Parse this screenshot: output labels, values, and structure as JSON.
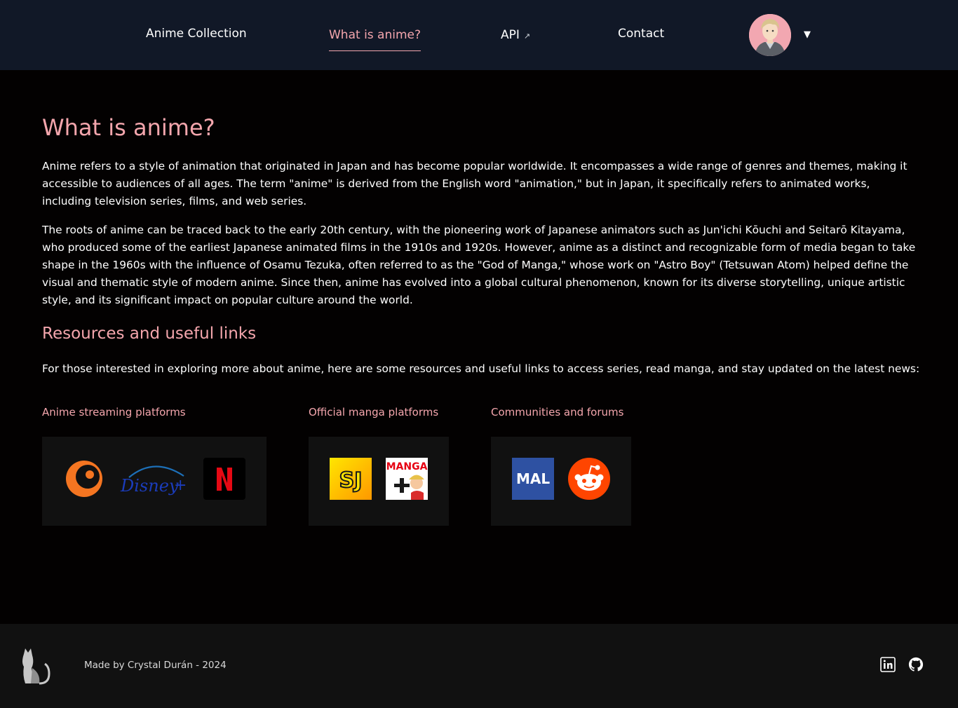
{
  "nav": {
    "items": [
      {
        "label": "Anime Collection"
      },
      {
        "label": "What is anime?"
      },
      {
        "label": "API",
        "ext_icon": "↗"
      },
      {
        "label": "Contact"
      }
    ],
    "menu_caret": "▼"
  },
  "main": {
    "title": "What is anime?",
    "paragraphs": [
      "Anime refers to a style of animation that originated in Japan and has become popular worldwide. It encompasses a wide range of genres and themes, making it accessible to audiences of all ages. The term \"anime\" is derived from the English word \"animation,\" but in Japan, it specifically refers to animated works, including television series, films, and web series.",
      "The roots of anime can be traced back to the early 20th century, with the pioneering work of Japanese animators such as Jun'ichi Kōuchi and Seitarō Kitayama, who produced some of the earliest Japanese animated films in the 1910s and 1920s. However, anime as a distinct and recognizable form of media began to take shape in the 1960s with the influence of Osamu Tezuka, often referred to as the \"God of Manga,\" whose work on \"Astro Boy\" (Tetsuwan Atom) helped define the visual and thematic style of modern anime. Since then, anime has evolved into a global cultural phenomenon, known for its diverse storytelling, unique artistic style, and its significant impact on popular culture around the world."
    ],
    "resources_title": "Resources and useful links",
    "resources_intro": "For those interested in exploring more about anime, here are some resources and useful links to access series, read manga, and stay updated on the latest news:",
    "categories": [
      {
        "title": "Anime streaming platforms",
        "logos": [
          "crunchyroll-icon",
          "disney-plus-icon",
          "netflix-icon"
        ]
      },
      {
        "title": "Official manga platforms",
        "logos": [
          "shonen-jump-icon",
          "manga-plus-icon"
        ],
        "logo_text": {
          "sj": "SJ",
          "manga": "MANGA"
        }
      },
      {
        "title": "Communities and forums",
        "logos": [
          "myanimelist-icon",
          "reddit-icon"
        ],
        "logo_text": {
          "mal": "MAL"
        }
      }
    ]
  },
  "footer": {
    "credit": "Made by Crystal Durán - 2024",
    "social": [
      "linkedin-icon",
      "github-icon"
    ]
  },
  "colors": {
    "header_bg": "#111827",
    "body_bg": "#030101",
    "accent": "#f4a6ad",
    "card_bg": "#111111"
  }
}
